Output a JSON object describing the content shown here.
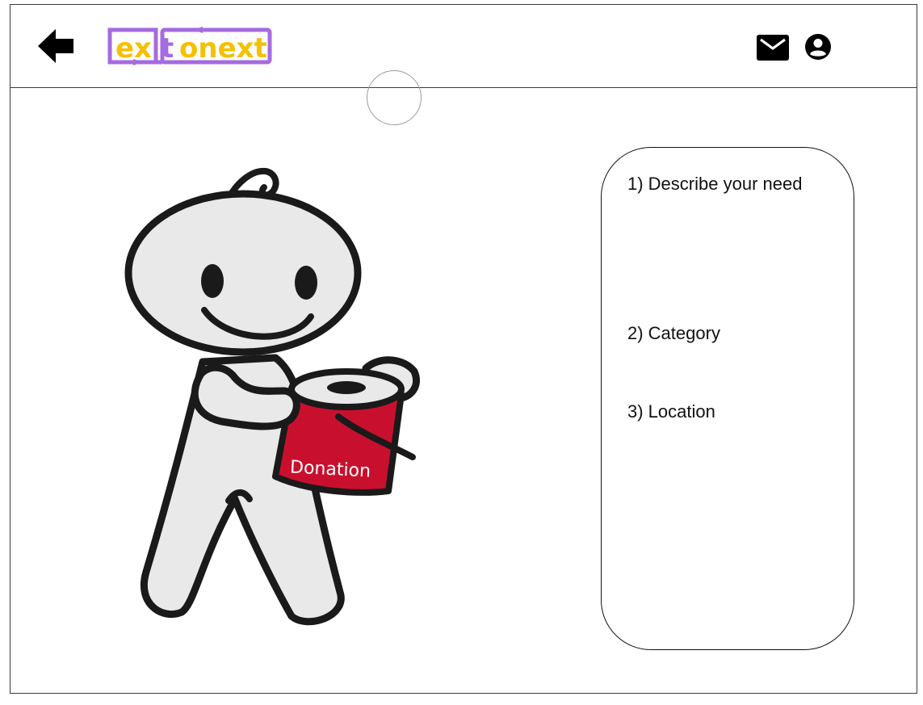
{
  "header": {
    "logo": {
      "text": "extonext",
      "colors": {
        "letters": "#f5c000",
        "frame": "#a56be0"
      },
      "icon_name": "extonext-logo"
    },
    "icons": {
      "back": "back-arrow-icon",
      "mail": "mail-icon",
      "account": "account-circle-icon"
    }
  },
  "illustration": {
    "label": "Donation",
    "colors": {
      "can": "#c8102e",
      "body": "#e9e9e9",
      "outline": "#1a1a1a"
    }
  },
  "form": {
    "steps": [
      {
        "label": "1) Describe your need"
      },
      {
        "label": "2) Category"
      },
      {
        "label": "3) Location"
      }
    ]
  }
}
